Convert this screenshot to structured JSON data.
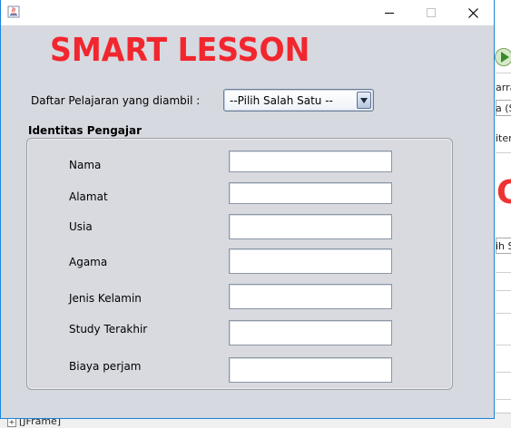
{
  "window": {
    "title": "",
    "controls": {
      "minimize": "minimize",
      "maximize": "maximize",
      "close": "close"
    }
  },
  "app": {
    "title": "SMART LESSON",
    "accent_color": "#f2262e"
  },
  "course": {
    "label": "Daftar Pelajaran yang diambil :",
    "selected": "--Pilih Salah Satu --"
  },
  "teacher": {
    "section_title": "Identitas Pengajar",
    "fields": [
      {
        "label": "Nama",
        "value": ""
      },
      {
        "label": "Alamat",
        "value": ""
      },
      {
        "label": "Usia",
        "value": ""
      },
      {
        "label": "Agama",
        "value": ""
      },
      {
        "label": "Jenis Kelamin",
        "value": ""
      },
      {
        "label": "Study Terakhir",
        "value": ""
      },
      {
        "label": "Biaya perjam",
        "value": ""
      }
    ]
  },
  "background": {
    "fragments": [
      "arra",
      "a (S",
      "item",
      "O",
      "ih S"
    ],
    "tree_item": "[JFrame]"
  }
}
